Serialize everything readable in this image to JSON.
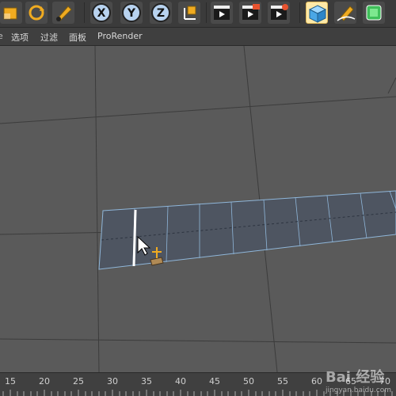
{
  "toolbar": {
    "buttons": [
      {
        "icon": "scale-icon"
      },
      {
        "icon": "rotate-icon"
      },
      {
        "icon": "live-selection-icon"
      },
      {
        "icon": "x-axis-lock-icon",
        "label": "X"
      },
      {
        "icon": "y-axis-lock-icon",
        "label": "Y"
      },
      {
        "icon": "z-axis-lock-icon",
        "label": "Z"
      },
      {
        "icon": "coordinate-system-icon"
      },
      {
        "icon": "render-view-icon"
      },
      {
        "icon": "render-to-picture-viewer-icon"
      },
      {
        "icon": "render-settings-icon"
      },
      {
        "icon": "cube-icon"
      },
      {
        "icon": "pen-spline-icon"
      },
      {
        "icon": "subdivision-surface-icon"
      }
    ]
  },
  "menu": {
    "items": [
      "选项",
      "过滤",
      "面板",
      "ProRender"
    ]
  },
  "timeline": {
    "ticks": [
      "15",
      "20",
      "25",
      "30",
      "35",
      "40",
      "45",
      "50",
      "55",
      "60",
      "65",
      "70"
    ]
  },
  "watermark": {
    "brand": "Bai 经验",
    "url": "jingyan.baidu.com"
  },
  "colors": {
    "viewport_bg": "#5a5a5a",
    "plane_fill": "#4e5561",
    "plane_edge": "#8fb6d9",
    "selected_edge": "#ffffff",
    "axis_x": "#3a74c8",
    "axis_y": "#f0ab20",
    "axis_z": "#f03c8c"
  }
}
